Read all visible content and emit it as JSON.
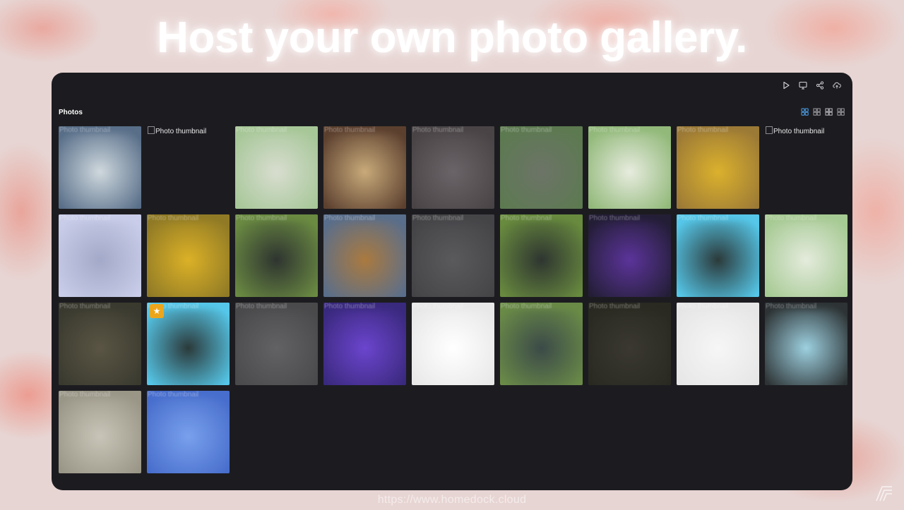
{
  "headline": "Host your own photo gallery.",
  "toolbar": {
    "buttons": [
      {
        "icon": "play-icon"
      },
      {
        "icon": "monitor-icon"
      },
      {
        "icon": "share-icon"
      },
      {
        "icon": "cloud-upload-icon"
      }
    ]
  },
  "photos_section": {
    "title": "Photos",
    "view_modes": [
      "grid-large-icon",
      "grid-medium-icon",
      "grid-small-icon",
      "grid-xsmall-icon"
    ],
    "active_view_mode": 0,
    "thumbnail_alt": "Photo thumbnail",
    "thumbnails": [
      {
        "colors": [
          "#5a6f88",
          "#cfd8dd"
        ],
        "broken": false,
        "favorite": false
      },
      {
        "colors": [],
        "broken": true,
        "favorite": false
      },
      {
        "colors": [
          "#a8c79a",
          "#d8ddd0"
        ],
        "broken": false,
        "favorite": false
      },
      {
        "colors": [
          "#5b4030",
          "#c7aa7c"
        ],
        "broken": false,
        "favorite": false
      },
      {
        "colors": [
          "#4a4446",
          "#6a6468"
        ],
        "broken": false,
        "favorite": false
      },
      {
        "colors": [
          "#5e7a52",
          "#6c7468"
        ],
        "broken": false,
        "favorite": false
      },
      {
        "colors": [
          "#93b87c",
          "#e7ecdf"
        ],
        "broken": false,
        "favorite": false
      },
      {
        "colors": [
          "#9a7a3a",
          "#d9b133"
        ],
        "broken": false,
        "favorite": false
      },
      {
        "colors": [],
        "broken": true,
        "favorite": false
      },
      {
        "colors": [
          "#c9cde8",
          "#a3a9c7"
        ],
        "broken": false,
        "favorite": false
      },
      {
        "colors": [
          "#8f7a2a",
          "#d9b12d"
        ],
        "broken": false,
        "favorite": false
      },
      {
        "colors": [
          "#6c8a45",
          "#2e3430"
        ],
        "broken": false,
        "favorite": false
      },
      {
        "colors": [
          "#5a6e8a",
          "#a87a42"
        ],
        "broken": false,
        "favorite": false
      },
      {
        "colors": [
          "#454548",
          "#5a5a5d"
        ],
        "broken": false,
        "favorite": false
      },
      {
        "colors": [
          "#6a8a42",
          "#2e3530"
        ],
        "broken": false,
        "favorite": false
      },
      {
        "colors": [
          "#241e36",
          "#5a3596"
        ],
        "broken": false,
        "favorite": false
      },
      {
        "colors": [
          "#5ac6e6",
          "#2c3a3a"
        ],
        "broken": false,
        "favorite": false
      },
      {
        "colors": [
          "#a7c995",
          "#e4ebdd"
        ],
        "broken": false,
        "favorite": false
      },
      {
        "colors": [
          "#3a3a30",
          "#5a5545"
        ],
        "broken": false,
        "favorite": false
      },
      {
        "colors": [
          "#5ac6e6",
          "#2c3a3a"
        ],
        "broken": false,
        "favorite": true
      },
      {
        "colors": [
          "#4a4a4c",
          "#626264"
        ],
        "broken": false,
        "favorite": false
      },
      {
        "colors": [
          "#3a2a7a",
          "#6a46c8"
        ],
        "broken": false,
        "favorite": false
      },
      {
        "colors": [
          "#e8e8e8",
          "#ffffff"
        ],
        "broken": false,
        "favorite": false
      },
      {
        "colors": [
          "#6b8a4a",
          "#3c4a48"
        ],
        "broken": false,
        "favorite": false
      },
      {
        "colors": [
          "#2a2a22",
          "#3a3830"
        ],
        "broken": false,
        "favorite": false
      },
      {
        "colors": [
          "#e6e6e6",
          "#f6f6f6"
        ],
        "broken": false,
        "favorite": false
      },
      {
        "colors": [
          "#2e3436",
          "#9fd0de"
        ],
        "broken": false,
        "favorite": false
      },
      {
        "colors": [
          "#9a9688",
          "#c8c4b8"
        ],
        "broken": false,
        "favorite": false
      },
      {
        "colors": [
          "#4a6ec8",
          "#7aa0e8"
        ],
        "broken": false,
        "favorite": false
      }
    ]
  },
  "footer": {
    "url": "https://www.homedock.cloud"
  },
  "brand_logo": {
    "icon": "homedock-logo-icon"
  }
}
